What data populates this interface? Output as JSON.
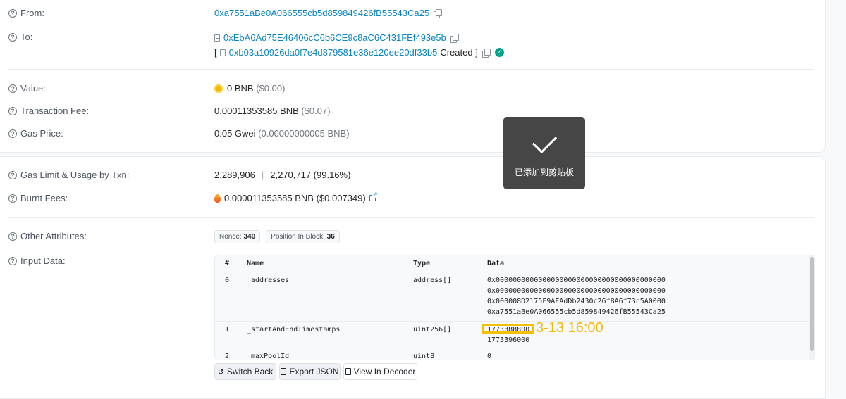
{
  "from": {
    "label": "From:",
    "address": "0xa7551aBe0A066555cb5d859849426fB55543Ca25"
  },
  "to": {
    "label": "To:",
    "address": "0xEbA6Ad75E46406cC6b6CE9c8aC6C431FEf493e5b",
    "created_open": "[",
    "created_address": "0xb03a10926da0f7e4d879581e36e120ee20df33b5",
    "created_text": "Created ]"
  },
  "value": {
    "label": "Value:",
    "amount": "0 BNB",
    "usd": "($0.00)"
  },
  "fee": {
    "label": "Transaction Fee:",
    "amount": "0.00011353585 BNB",
    "usd": "($0.07)"
  },
  "gas_price": {
    "label": "Gas Price:",
    "amount": "0.05 Gwei",
    "bnb": "(0.00000000005 BNB)"
  },
  "gas_limit": {
    "label": "Gas Limit & Usage by Txn:",
    "limit": "2,289,906",
    "separator": "|",
    "usage": "2,270,717 (99.16%)"
  },
  "burnt": {
    "label": "Burnt Fees:",
    "amount": "0.000011353585 BNB",
    "usd": "($0.007349)"
  },
  "other": {
    "label": "Other Attributes:",
    "nonce_label": "Nonce:",
    "nonce": "340",
    "position_label": "Position In Block:",
    "position": "36"
  },
  "input": {
    "label": "Input Data:",
    "headers": {
      "idx": "#",
      "name": "Name",
      "type": "Type",
      "data": "Data"
    },
    "rows": [
      {
        "idx": "0",
        "name": "_addresses",
        "type": "address[]",
        "data": [
          "0x0000000000000000000000000000000000000000",
          "0x0000000000000000000000000000000000000000",
          "0x000008D2175F9AEAdDb2430c26f8A6f73c5A0000",
          "0xa7551aBe0A066555cb5d859849426fB55543Ca25"
        ]
      },
      {
        "idx": "1",
        "name": "_startAndEndTimestamps",
        "type": "uint256[]",
        "data": [
          "1773388800",
          "1773396000"
        ]
      },
      {
        "idx": "2",
        "name": "_maxPoolId",
        "type": "uint8",
        "data": [
          "0"
        ]
      }
    ],
    "annotation": "3-13 16:00"
  },
  "buttons": {
    "switch_back": "Switch Back",
    "export_json": "Export JSON",
    "view_decoder": "View In Decoder"
  },
  "toast": {
    "message": "已添加到剪贴板"
  },
  "colors": {
    "link": "#0784c3",
    "highlight": "#f6c000",
    "success": "#00a186"
  }
}
